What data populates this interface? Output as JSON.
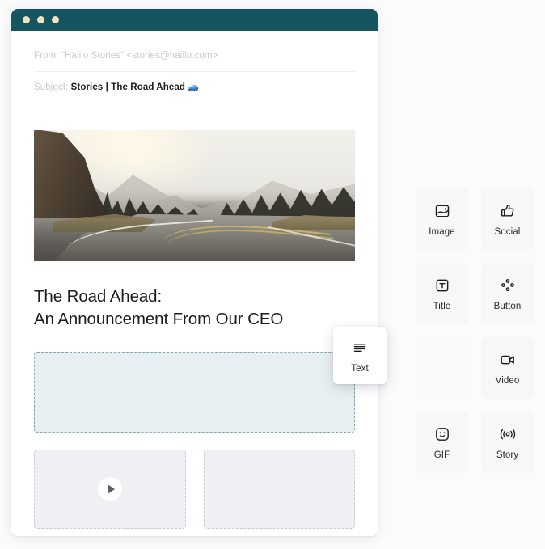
{
  "window": {
    "title_bar_color": "#16555f",
    "dot_color": "#f5e3bd",
    "dots": [
      "window-dot-1",
      "window-dot-2",
      "window-dot-3"
    ]
  },
  "email": {
    "from_label": "From:",
    "from_value": "\"Haiilo Stories\"  <stories@haiilo.com>",
    "subject_label": "Subject:",
    "subject_value": "Stories | The Road Ahead",
    "subject_emoji": "🚙",
    "hero_image_alt": "mountain-road-at-sunrise",
    "headline_line_1": "The Road Ahead:",
    "headline_line_2": "An Announcement From Our CEO",
    "drop_zone_fill": "#e7eff2",
    "drop_zone_border": "#7fa8b2",
    "placeholder_fill": "#eff0f3",
    "placeholder_border": "#c8ccd3",
    "placeholders": [
      {
        "name": "video-placeholder",
        "has_play_button": true
      },
      {
        "name": "empty-placeholder",
        "has_play_button": false
      }
    ]
  },
  "palette": {
    "tiles": [
      {
        "label": "Image",
        "icon": "image-icon",
        "empty": false
      },
      {
        "label": "Social",
        "icon": "thumbs-up-icon",
        "empty": false
      },
      {
        "label": "Title",
        "icon": "title-t-icon",
        "empty": false
      },
      {
        "label": "Button",
        "icon": "button-dots-icon",
        "empty": false
      },
      {
        "label": "",
        "icon": "",
        "empty": true
      },
      {
        "label": "Video",
        "icon": "video-camera-icon",
        "empty": false
      },
      {
        "label": "GIF",
        "icon": "smiley-face-icon",
        "empty": false
      },
      {
        "label": "Story",
        "icon": "broadcast-icon",
        "empty": false
      }
    ],
    "tile_bg": "#f7f7f8"
  },
  "drag": {
    "label": "Text",
    "icon": "text-lines-icon"
  }
}
